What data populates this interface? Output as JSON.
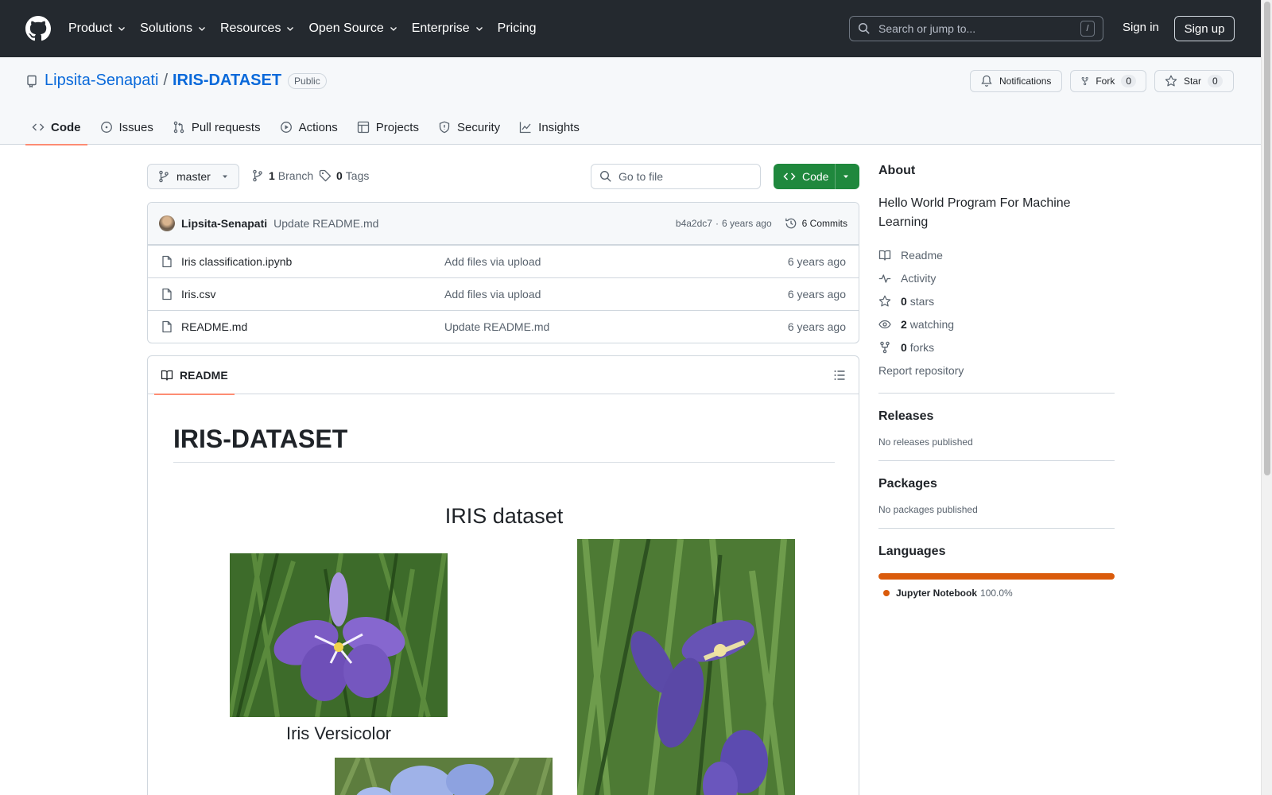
{
  "header": {
    "nav": [
      {
        "label": "Product",
        "has_menu": true
      },
      {
        "label": "Solutions",
        "has_menu": true
      },
      {
        "label": "Resources",
        "has_menu": true
      },
      {
        "label": "Open Source",
        "has_menu": true
      },
      {
        "label": "Enterprise",
        "has_menu": true
      },
      {
        "label": "Pricing",
        "has_menu": false
      }
    ],
    "search_placeholder": "Search or jump to...",
    "search_shortcut": "/",
    "sign_in": "Sign in",
    "sign_up": "Sign up"
  },
  "repo": {
    "owner": "Lipsita-Senapati",
    "separator": "/",
    "name": "IRIS-DATASET",
    "visibility": "Public",
    "notifications_label": "Notifications",
    "fork_label": "Fork",
    "fork_count": "0",
    "star_label": "Star",
    "star_count": "0",
    "tabs": [
      {
        "label": "Code",
        "icon": "code-icon",
        "active": true
      },
      {
        "label": "Issues",
        "icon": "issue-icon",
        "active": false
      },
      {
        "label": "Pull requests",
        "icon": "pull-request-icon",
        "active": false
      },
      {
        "label": "Actions",
        "icon": "play-icon",
        "active": false
      },
      {
        "label": "Projects",
        "icon": "table-icon",
        "active": false
      },
      {
        "label": "Security",
        "icon": "shield-icon",
        "active": false
      },
      {
        "label": "Insights",
        "icon": "graph-icon",
        "active": false
      }
    ]
  },
  "toolbar": {
    "branch": "master",
    "branch_count": "1",
    "branch_label": "Branch",
    "tag_count": "0",
    "tag_label": "Tags",
    "goto_placeholder": "Go to file",
    "code_label": "Code"
  },
  "latest_commit": {
    "author": "Lipsita-Senapati",
    "message": "Update README.md",
    "sha": "b4a2dc7",
    "dot": "·",
    "age": "6 years ago",
    "commits_label": "6 Commits"
  },
  "files": [
    {
      "name": "Iris classification.ipynb",
      "message": "Add files via upload",
      "age": "6 years ago"
    },
    {
      "name": "Iris.csv",
      "message": "Add files via upload",
      "age": "6 years ago"
    },
    {
      "name": "README.md",
      "message": "Update README.md",
      "age": "6 years ago"
    }
  ],
  "readme": {
    "tab_label": "README",
    "heading": "IRIS-DATASET",
    "figure_title": "IRIS dataset",
    "caption_1": "Iris Versicolor"
  },
  "sidebar": {
    "about_title": "About",
    "description": "Hello World Program For Machine Learning",
    "links": [
      {
        "icon": "book-icon",
        "count": "",
        "label": "Readme"
      },
      {
        "icon": "pulse-icon",
        "count": "",
        "label": "Activity"
      },
      {
        "icon": "star-icon",
        "count": "0",
        "label": "stars"
      },
      {
        "icon": "eye-icon",
        "count": "2",
        "label": "watching"
      },
      {
        "icon": "fork-icon",
        "count": "0",
        "label": "forks"
      }
    ],
    "report": "Report repository",
    "releases_title": "Releases",
    "releases_sub": "No releases published",
    "packages_title": "Packages",
    "packages_sub": "No packages published",
    "languages_title": "Languages",
    "language": {
      "name": "Jupyter Notebook",
      "percent": "100.0%",
      "color": "#da5b0b",
      "share": 100
    }
  },
  "colors": {
    "header_bg": "#24292f",
    "link": "#0969da",
    "accent_tab": "#fd8c73",
    "primary_button": "#1f883d"
  }
}
